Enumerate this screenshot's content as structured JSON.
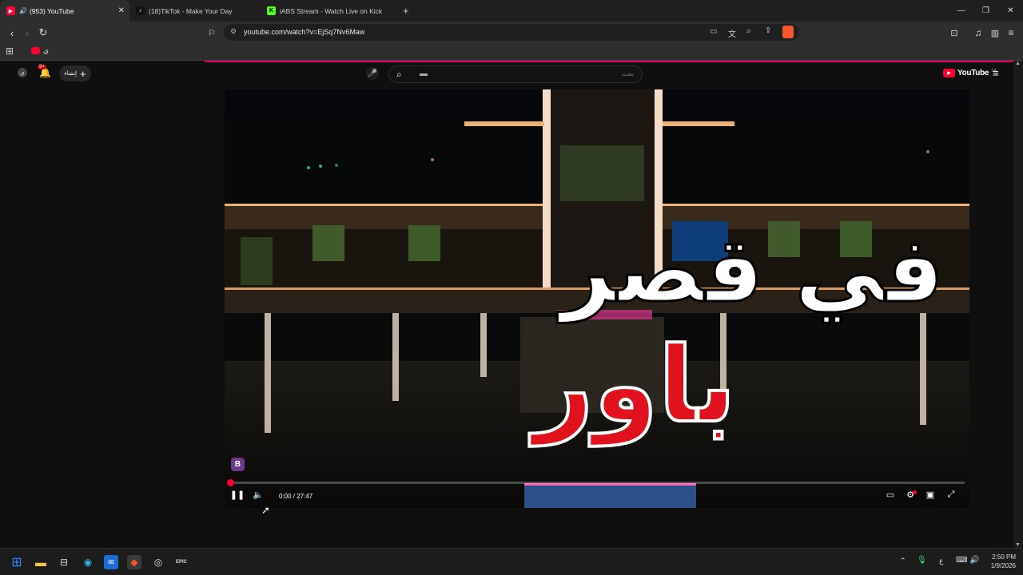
{
  "browser": {
    "tabs": [
      {
        "title": "(953) YouTube",
        "active": true
      },
      {
        "title": "(18)TikTok - Make Your Day",
        "active": false
      },
      {
        "title": "iABS Stream - Watch Live on Kick",
        "active": false
      }
    ],
    "new_tab": "+",
    "url": "youtube.com/watch?v=EjSq7Nv6Maw",
    "bookmark_label": "ي"
  },
  "youtube": {
    "logo_text": "YouTube",
    "region": "SA",
    "search_placeholder": "بحث",
    "create_label": "إنشاء",
    "notifications_count": "9+"
  },
  "video": {
    "overlay_title_1": "في قصر",
    "overlay_title_2": "باور",
    "time": "0:00 / 27:47",
    "progress": 0,
    "channel_badge": "B"
  },
  "taskbar": {
    "time": "2:50 PM",
    "date": "1/9/2026",
    "lang": "ع"
  },
  "colors": {
    "accent": "#ff0033",
    "tab_active": "#2e2e2e",
    "background": "#0f0f0f"
  }
}
